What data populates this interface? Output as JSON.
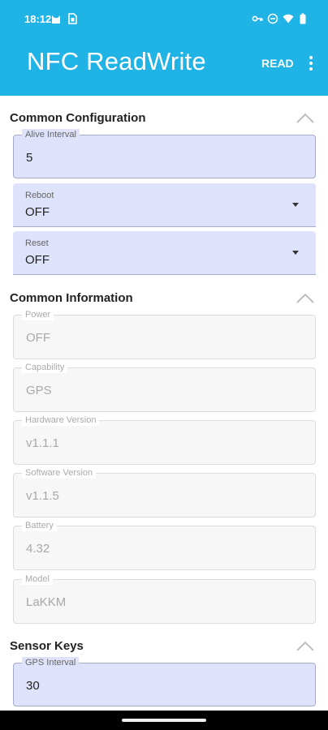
{
  "status_bar": {
    "time": "18:12",
    "icons": [
      "cat-icon",
      "sim-card-icon",
      "vpn-key-icon",
      "do-not-disturb-icon",
      "wifi-icon",
      "battery-icon"
    ]
  },
  "app_bar": {
    "title": "NFC ReadWrite",
    "read_label": "READ",
    "overflow_icon": "more-vert-icon"
  },
  "colors": {
    "accent": "#1fb3e6",
    "field_fill": "#dfe2fb",
    "disabled_fill": "#f7f7f7"
  },
  "sections": {
    "common_configuration": {
      "title": "Common Configuration",
      "alive_interval": {
        "label": "Alive Interval",
        "value": "5"
      },
      "reboot": {
        "label": "Reboot",
        "value": "OFF"
      },
      "reset": {
        "label": "Reset",
        "value": "OFF"
      }
    },
    "common_information": {
      "title": "Common Information",
      "power": {
        "label": "Power",
        "value": "OFF"
      },
      "capability": {
        "label": "Capability",
        "value": "GPS"
      },
      "hardware_version": {
        "label": "Hardware Version",
        "value": "v1.1.1"
      },
      "software_version": {
        "label": "Software Version",
        "value": "v1.1.5"
      },
      "battery": {
        "label": "Battery",
        "value": "4.32"
      },
      "model": {
        "label": "Model",
        "value": "LaKKM"
      }
    },
    "sensor_keys": {
      "title": "Sensor Keys",
      "gps_interval": {
        "label": "GPS Interval",
        "value": "30"
      }
    }
  }
}
